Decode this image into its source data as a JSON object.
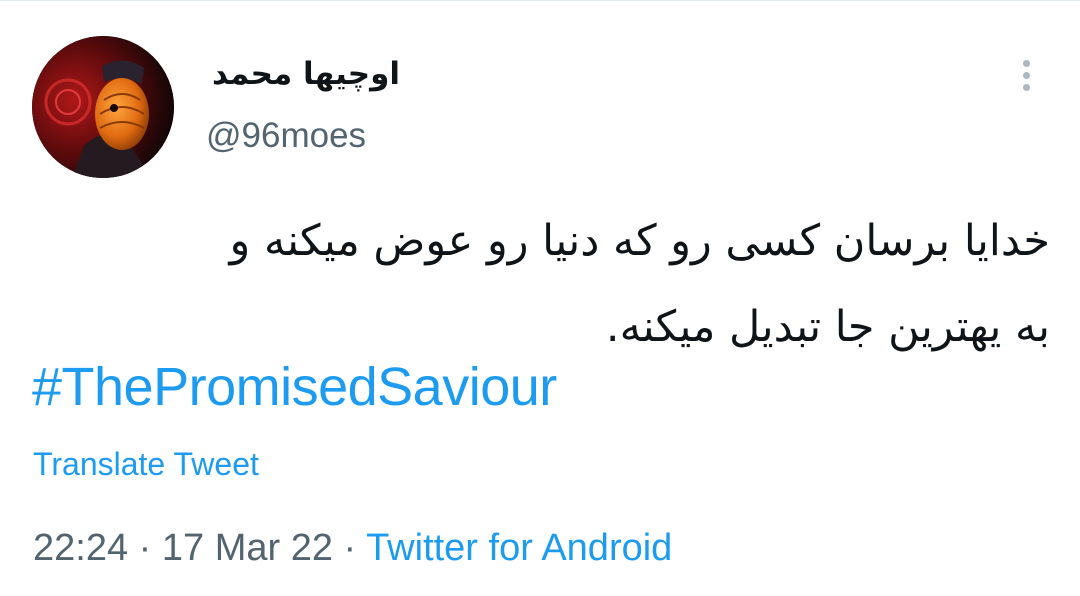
{
  "tweet": {
    "author": {
      "display_name": "اوچیها محمد",
      "handle": "@96moes",
      "avatar_icon": "masked-character-avatar"
    },
    "text_lines": [
      "خدایا برسان کسی رو که دنیا رو عوض میکنه و",
      "به یهترین جا تبدیل میکنه."
    ],
    "hashtag": "#ThePromisedSaviour",
    "translate_label": "Translate Tweet",
    "time": "22:24",
    "separator": "·",
    "date": "17 Mar 22",
    "source": "Twitter for Android",
    "menu_icon": "more-vertical-icon",
    "colors": {
      "link": "#1d9bf0",
      "text": "#0f1419",
      "secondary": "#536471"
    }
  }
}
